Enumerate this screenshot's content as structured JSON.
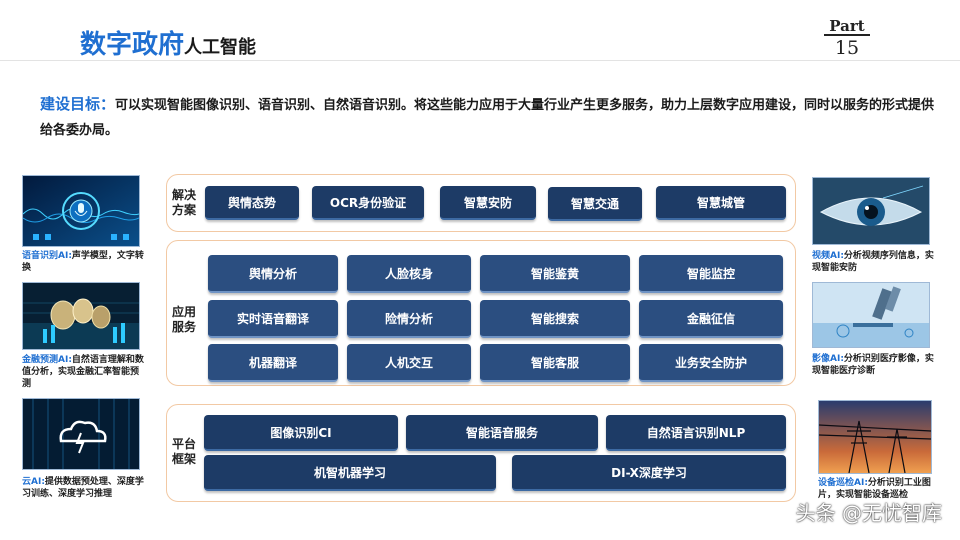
{
  "header": {
    "title_main": "数字政府",
    "title_sub": "人工智能",
    "part_label": "Part",
    "part_number": "15"
  },
  "goal": {
    "label": "建设目标：",
    "text": "可以实现智能图像识别、语音识别、自然语音识别。将这些能力应用于大量行业产生更多服务，助力上层数字应用建设，同时以服务的形式提供给各委办局。"
  },
  "left_panels": [
    {
      "highlight": "语音识别AI:",
      "text": "声学模型，文字转换",
      "image_icon": "microphone-icon"
    },
    {
      "highlight": "金融预测AI:",
      "text": "自然语言理解和数值分析，实现金融汇率智能预测",
      "image_icon": "coins-icon"
    },
    {
      "highlight": "云AI:",
      "text": "提供数据预处理、深度学习训练、深度学习推理",
      "image_icon": "cloud-icon"
    }
  ],
  "right_panels": [
    {
      "highlight": "视频AI:",
      "text": "分析视频序列信息，实现智能安防",
      "image_icon": "eye-icon"
    },
    {
      "highlight": "影像AI:",
      "text": "分析识别医疗影像，实现智能医疗诊断",
      "image_icon": "microscope-icon"
    },
    {
      "highlight": "设备巡检AI:",
      "text": "分析识别工业图片，实现智能设备巡检",
      "image_icon": "power-tower-icon"
    }
  ],
  "sections": {
    "solutions": {
      "label": "解决方案",
      "items": [
        "舆情态势",
        "OCR身份验证",
        "智慧安防",
        "智慧交通",
        "智慧城管"
      ]
    },
    "services": {
      "label": "应用服务",
      "items": [
        "舆情分析",
        "人脸核身",
        "智能鉴黄",
        "智能监控",
        "实时语音翻译",
        "险情分析",
        "智能搜索",
        "金融征信",
        "机器翻译",
        "人机交互",
        "智能客服",
        "业务安全防护"
      ]
    },
    "platform": {
      "label": "平台框架",
      "items": [
        "图像识别CI",
        "智能语音服务",
        "自然语言识别NLP",
        "机智机器学习",
        "DI-X深度学习"
      ]
    }
  },
  "watermark": "头条 @无忧智库",
  "colors": {
    "accent_blue": "#1f6fd1",
    "box_dark_navy": "#1d3b66",
    "box_service_blue": "#2b4e80",
    "section_border_peach": "#f2c9a4"
  }
}
